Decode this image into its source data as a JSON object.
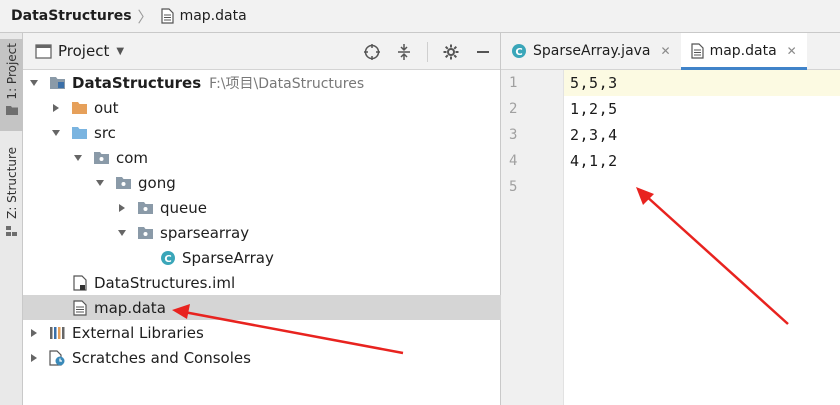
{
  "breadcrumb": {
    "project": "DataStructures",
    "file": "map.data"
  },
  "toolstrip": {
    "project_tab": "1: Project",
    "structure_tab": "Z: Structure"
  },
  "project_panel": {
    "title": "Project",
    "tree": [
      {
        "label": "DataStructures",
        "path": "F:\\项目\\DataStructures"
      },
      {
        "label": "out"
      },
      {
        "label": "src"
      },
      {
        "label": "com"
      },
      {
        "label": "gong"
      },
      {
        "label": "queue"
      },
      {
        "label": "sparsearray"
      },
      {
        "label": "SparseArray"
      },
      {
        "label": "DataStructures.iml"
      },
      {
        "label": "map.data"
      },
      {
        "label": "External Libraries"
      },
      {
        "label": "Scratches and Consoles"
      }
    ]
  },
  "editor": {
    "tabs": [
      {
        "label": "SparseArray.java"
      },
      {
        "label": "map.data"
      }
    ],
    "lines": [
      {
        "no": "1",
        "text": "5,5,3"
      },
      {
        "no": "2",
        "text": "1,2,5"
      },
      {
        "no": "3",
        "text": "2,3,4"
      },
      {
        "no": "4",
        "text": "4,1,2"
      },
      {
        "no": "5",
        "text": ""
      }
    ]
  },
  "colors": {
    "accent": "#4083c9",
    "annotation_arrow": "#e8231f",
    "selection": "#d5d5d5",
    "current_line": "#fcfae2",
    "folder_orange": "#e6a05a",
    "folder_blue": "#7ab4e0",
    "package_gray": "#8a9aa8",
    "class_teal": "#3aa6b9"
  }
}
